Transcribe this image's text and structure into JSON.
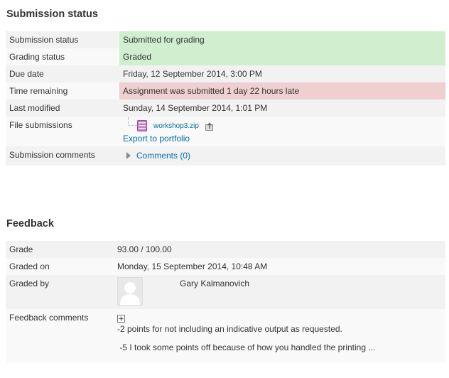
{
  "submission": {
    "heading": "Submission status",
    "rows": [
      {
        "label": "Submission status",
        "value": "Submitted for grading"
      },
      {
        "label": "Grading status",
        "value": "Graded"
      },
      {
        "label": "Due date",
        "value": "Friday, 12 September 2014, 3:00 PM"
      },
      {
        "label": "Time remaining",
        "value": "Assignment was submitted 1 day 22 hours late"
      },
      {
        "label": "Last modified",
        "value": "Sunday, 14 September 2014, 1:01 PM"
      },
      {
        "label": "File submissions",
        "file_name": "workshop3.zip",
        "export_link": "Export to portfolio"
      },
      {
        "label": "Submission comments",
        "comments_link": "Comments (0)"
      }
    ],
    "colors": {
      "submitted_bg": "#cfefcf",
      "late_bg": "#efcfcf",
      "link": "#0070a8"
    }
  },
  "feedback": {
    "heading": "Feedback",
    "rows": [
      {
        "label": "Grade",
        "value": "93.00 / 100.00"
      },
      {
        "label": "Graded on",
        "value": "Monday, 15 September 2014, 10:48 AM"
      },
      {
        "label": "Graded by",
        "value": "Gary Kalmanovich"
      },
      {
        "label": "Feedback comments",
        "lines": [
          "-2 points for not including an indicative output as requested.",
          " -5 I took some points off because of how you handled the printing ..."
        ]
      }
    ]
  }
}
